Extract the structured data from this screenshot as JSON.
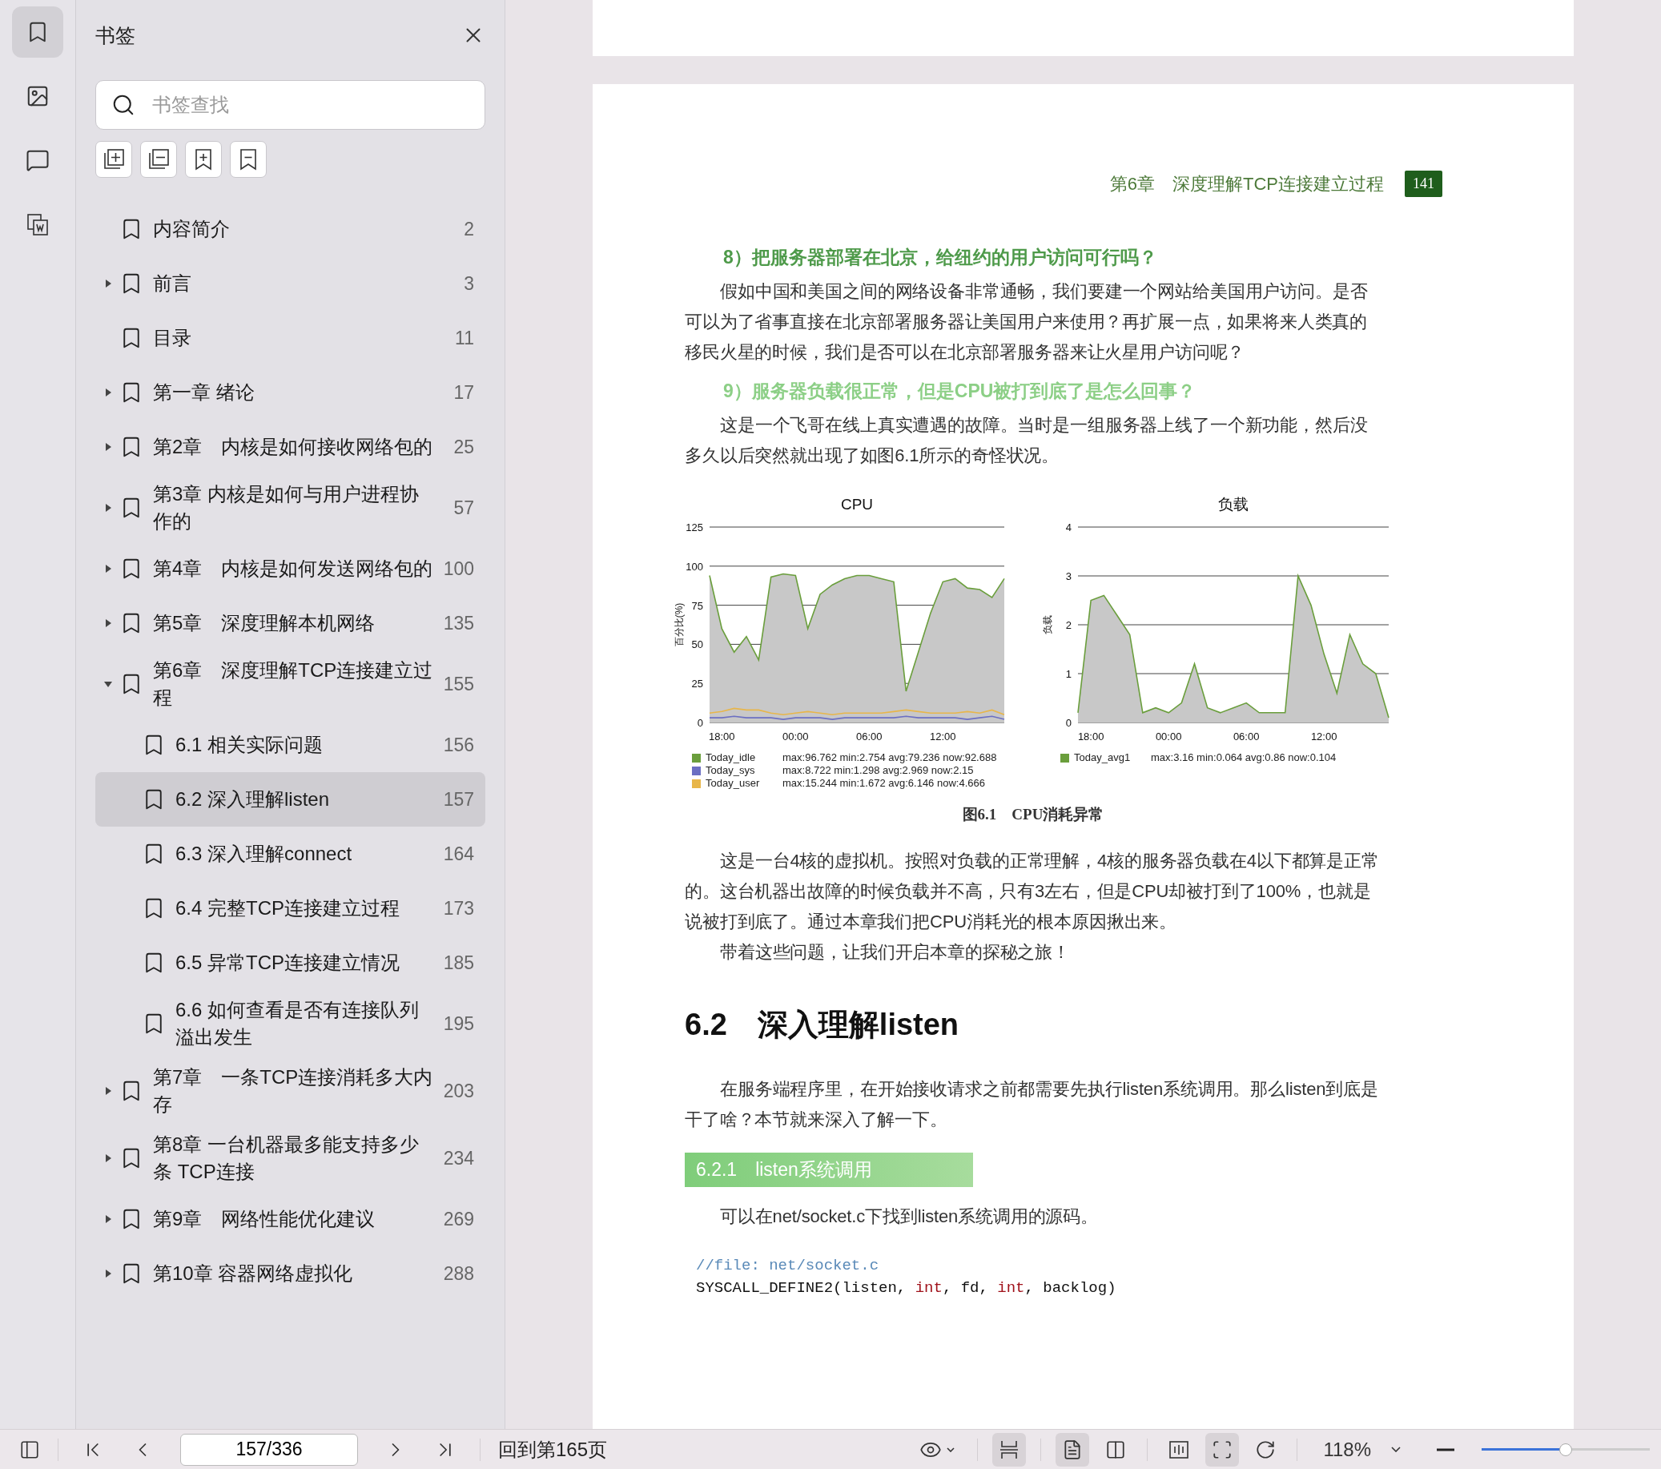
{
  "rail": [
    {
      "kind": "bookmarks",
      "selected": true
    },
    {
      "kind": "images",
      "selected": false
    },
    {
      "kind": "comments",
      "selected": false
    },
    {
      "kind": "pages",
      "selected": false
    }
  ],
  "sidebar": {
    "title": "书签",
    "search": {
      "placeholder": "书签查找"
    },
    "tools": [
      {
        "kind": "expand-all"
      },
      {
        "kind": "collapse-all"
      },
      {
        "kind": "add-bookmark"
      },
      {
        "kind": "remove-bookmark"
      }
    ],
    "items": [
      {
        "label": "内容简介",
        "page": "2",
        "selected": false
      },
      {
        "label": "前言",
        "page": "3",
        "expanded": false,
        "selected": false
      },
      {
        "label": "目录",
        "page": "11",
        "selected": false
      },
      {
        "label": "第一章 绪论",
        "page": "17",
        "expanded": false,
        "selected": false
      },
      {
        "label": "第2章　内核是如何接收网络包的",
        "page": "25",
        "expanded": false,
        "selected": false
      },
      {
        "label": "第3章 内核是如何与用户进程协作的",
        "page": "57",
        "expanded": false,
        "selected": false
      },
      {
        "label": "第4章　内核是如何发送网络包的",
        "page": "100",
        "expanded": false,
        "selected": false
      },
      {
        "label": "第5章　深度理解本机网络",
        "page": "135",
        "expanded": false,
        "selected": false
      },
      {
        "label": "第6章　深度理解TCP连接建立过程",
        "page": "155",
        "expanded": true,
        "selected": false,
        "children": [
          {
            "label": "6.1 相关实际问题",
            "page": "156",
            "selected": false
          },
          {
            "label": "6.2 深入理解listen",
            "page": "157",
            "selected": true
          },
          {
            "label": "6.3 深入理解connect",
            "page": "164",
            "selected": false
          },
          {
            "label": "6.4 完整TCP连接建立过程",
            "page": "173",
            "selected": false
          },
          {
            "label": "6.5 异常TCP连接建立情况",
            "page": "185",
            "selected": false
          },
          {
            "label": "6.6 如何查看是否有连接队列溢出发生",
            "page": "195",
            "selected": false
          }
        ]
      },
      {
        "label": "第7章　一条TCP连接消耗多大内存",
        "page": "203",
        "expanded": false,
        "selected": false
      },
      {
        "label": "第8章 一台机器最多能支持多少条 TCP连接",
        "page": "234",
        "expanded": false,
        "selected": false
      },
      {
        "label": "第9章　网络性能优化建议",
        "page": "269",
        "expanded": false,
        "selected": false
      },
      {
        "label": "第10章 容器网络虚拟化",
        "page": "288",
        "expanded": false,
        "selected": false
      }
    ]
  },
  "page": {
    "header": "第6章　深度理解TCP连接建立过程",
    "number": "141",
    "blocks": [
      {
        "kind": "question",
        "text": "8）把服务器部署在北京，给纽约的用户访问可行吗？"
      },
      {
        "kind": "paragraph",
        "text": "假如中国和美国之间的网络设备非常通畅，我们要建一个网站给美国用户访问。是否可以为了省事直接在北京部署服务器让美国用户来使用？再扩展一点，如果将来人类真的移民火星的时候，我们是否可以在北京部署服务器来让火星用户访问呢？"
      },
      {
        "kind": "question-faded",
        "text": "9）服务器负载很正常，但是CPU被打到底了是怎么回事？"
      },
      {
        "kind": "paragraph",
        "text": "这是一个飞哥在线上真实遭遇的故障。当时是一组服务器上线了一个新功能，然后没多久以后突然就出现了如图6.1所示的奇怪状况。"
      },
      {
        "kind": "figure"
      },
      {
        "kind": "paragraph",
        "text": "这是一台4核的虚拟机。按照对负载的正常理解，4核的服务器负载在4以下都算是正常的。这台机器出故障的时候负载并不高，只有3左右，但是CPU却被打到了100%，也就是说被打到底了。通过本章我们把CPU消耗光的根本原因揪出来。"
      },
      {
        "kind": "paragraph",
        "text": "带着这些问题，让我们开启本章的探秘之旅！"
      },
      {
        "kind": "section",
        "text": "6.2　深入理解listen"
      },
      {
        "kind": "paragraph",
        "text": "在服务端程序里，在开始接收请求之前都需要先执行listen系统调用。那么listen到底是干了啥？本节就来深入了解一下。"
      },
      {
        "kind": "subsection",
        "text": "6.2.1　listen系统调用"
      },
      {
        "kind": "paragraph",
        "text": "可以在net/socket.c下找到listen系统调用的源码。"
      },
      {
        "kind": "code",
        "lines": [
          [
            {
              "kind": "comment",
              "text": "//file: net/socket.c"
            }
          ],
          [
            {
              "kind": "plain",
              "text": "SYSCALL_DEFINE2(listen, "
            },
            {
              "kind": "keyword",
              "text": "int"
            },
            {
              "kind": "plain",
              "text": ", fd, "
            },
            {
              "kind": "keyword",
              "text": "int"
            },
            {
              "kind": "plain",
              "text": ", backlog)"
            }
          ]
        ]
      }
    ],
    "figure": {
      "caption": "图6.1　CPU消耗异常",
      "charts": [
        {
          "chart_data": {
            "type": "line",
            "grid": true,
            "title": "CPU",
            "ylabel": "百分比(%)",
            "categories": [
              null,
              "18:00",
              null,
              null,
              null,
              null,
              null,
              "00:00",
              null,
              null,
              null,
              null,
              null,
              "06:00",
              null,
              null,
              null,
              null,
              null,
              "12:00",
              null,
              null,
              null,
              null,
              null
            ],
            "ylim": [
              0,
              125
            ],
            "yticks": [
              0,
              25,
              50,
              75,
              100,
              125
            ],
            "series": [
              {
                "name": "Today_idle",
                "type": "area",
                "color": "#6a9e3c",
                "values": [
                  94,
                  60,
                  45,
                  55,
                  40,
                  93,
                  95,
                  94,
                  60,
                  82,
                  88,
                  92,
                  94,
                  94,
                  92,
                  90,
                  20,
                  45,
                  70,
                  90,
                  92,
                  86,
                  85,
                  80,
                  92
                ]
              },
              {
                "name": "Today_sys",
                "type": "line",
                "color": "#6b6fc2",
                "values": [
                  3,
                  3,
                  4,
                  3,
                  3,
                  3,
                  2,
                  3,
                  3,
                  3,
                  2,
                  3,
                  3,
                  3,
                  3,
                  3,
                  4,
                  3,
                  3,
                  3,
                  3,
                  2,
                  3,
                  4,
                  2
                ]
              },
              {
                "name": "Today_user",
                "type": "line",
                "color": "#e8b64a",
                "values": [
                  6,
                  7,
                  9,
                  8,
                  8,
                  6,
                  5,
                  6,
                  7,
                  6,
                  5,
                  6,
                  6,
                  6,
                  6,
                  7,
                  8,
                  7,
                  6,
                  6,
                  6,
                  7,
                  6,
                  8,
                  5
                ]
              }
            ]
          },
          "legend_stats": [
            "max:96.762 min:2.754 avg:79.236 now:92.688",
            "max:8.722 min:1.298 avg:2.969 now:2.15",
            "max:15.244 min:1.672 avg:6.146 now:4.666"
          ]
        },
        {
          "chart_data": {
            "type": "line",
            "grid": true,
            "title": "负载",
            "ylabel": "负载",
            "categories": [
              null,
              "18:00",
              null,
              null,
              null,
              null,
              null,
              "00:00",
              null,
              null,
              null,
              null,
              null,
              "06:00",
              null,
              null,
              null,
              null,
              null,
              "12:00",
              null,
              null,
              null,
              null,
              null
            ],
            "ylim": [
              0,
              4
            ],
            "yticks": [
              0,
              1,
              2,
              3,
              4
            ],
            "series": [
              {
                "name": "Today_avg1",
                "type": "area",
                "color": "#6a9e3c",
                "values": [
                  0.2,
                  2.5,
                  2.6,
                  2.2,
                  1.8,
                  0.2,
                  0.3,
                  0.2,
                  0.4,
                  1.2,
                  0.3,
                  0.2,
                  0.3,
                  0.4,
                  0.2,
                  0.2,
                  0.2,
                  3.0,
                  2.4,
                  1.4,
                  0.6,
                  1.8,
                  1.2,
                  1.0,
                  0.1
                ]
              }
            ]
          },
          "legend_stats": [
            "max:3.16 min:0.064 avg:0.86 now:0.104"
          ]
        }
      ]
    }
  },
  "toolbar": {
    "page_field": "157/336",
    "back_link": "回到第165页",
    "views": [
      {
        "kind": "scroll",
        "selected": true
      },
      {
        "kind": "single",
        "selected": true
      },
      {
        "kind": "double",
        "selected": false
      },
      {
        "kind": "spread",
        "selected": false
      },
      {
        "kind": "fit",
        "selected": true
      },
      {
        "kind": "rotate",
        "selected": false
      }
    ],
    "zoom": "118%",
    "zoom_slider": {
      "level": 0.5
    }
  }
}
